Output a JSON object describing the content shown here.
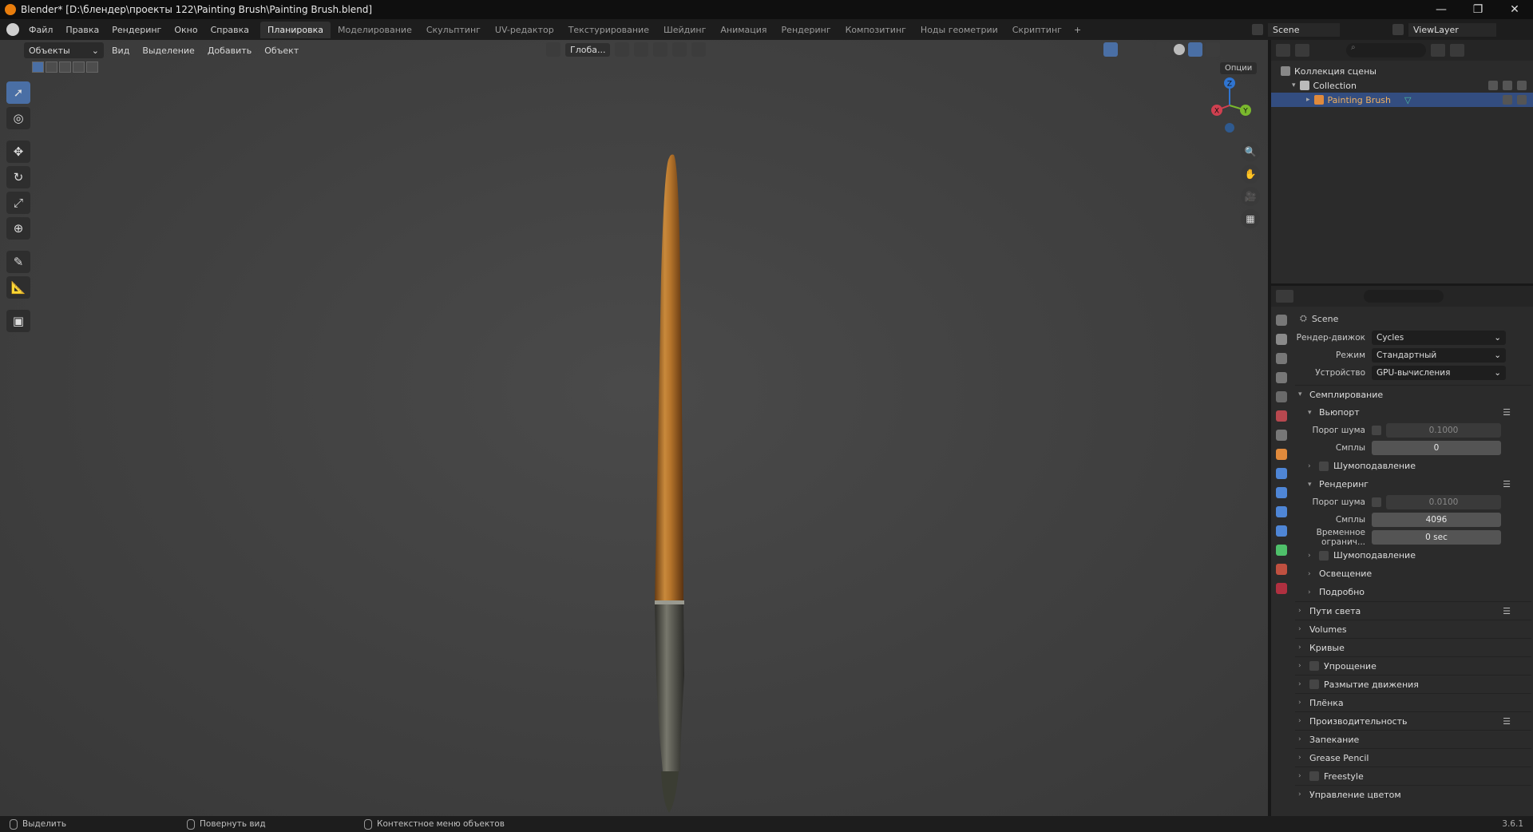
{
  "window": {
    "title": "Blender* [D:\\блендер\\проекты 122\\Painting Brush\\Painting Brush.blend]",
    "controls": [
      "—",
      "❐",
      "✕"
    ]
  },
  "menu": [
    "Файл",
    "Правка",
    "Рендеринг",
    "Окно",
    "Справка"
  ],
  "workspaces": {
    "tabs": [
      "Планировка",
      "Моделирование",
      "Скульптинг",
      "UV-редактор",
      "Текстурирование",
      "Шейдинг",
      "Анимация",
      "Рендеринг",
      "Композитинг",
      "Ноды геометрии",
      "Скриптинг"
    ],
    "active_index": 0,
    "add": "+"
  },
  "scene_selector": "Scene",
  "viewlayer_selector": "ViewLayer",
  "viewport": {
    "mode": "Объекты",
    "menus": [
      "Вид",
      "Выделение",
      "Добавить",
      "Объект"
    ],
    "orientation": "Глоба...",
    "options": "Опции"
  },
  "gizmo": {
    "z": "Z",
    "y": "Y",
    "x": "X"
  },
  "outliner": {
    "root": "Коллекция сцены",
    "collection": "Collection",
    "object": "Painting Brush"
  },
  "properties": {
    "context": "Scene",
    "render_engine": {
      "label": "Рендер-движок",
      "value": "Cycles"
    },
    "mode": {
      "label": "Режим",
      "value": "Стандартный"
    },
    "device": {
      "label": "Устройство",
      "value": "GPU-вычисления"
    },
    "sampling": "Семплирование",
    "viewport_sec": "Вьюпорт",
    "vp_noise": {
      "label": "Порог шума",
      "value": "0.1000"
    },
    "vp_samples": {
      "label": "Смплы",
      "value": "0"
    },
    "vp_denoise": "Шумоподавление",
    "render_sec": "Рендеринг",
    "r_noise": {
      "label": "Порог шума",
      "value": "0.0100"
    },
    "r_samples": {
      "label": "Смплы",
      "value": "4096"
    },
    "r_time": {
      "label": "Временное огранич...",
      "value": "0 sec"
    },
    "r_denoise": "Шумоподавление",
    "lights": "Освещение",
    "detail": "Подробно",
    "sections": [
      "Пути света",
      "Volumes",
      "Кривые",
      "Упрощение",
      "Размытие движения",
      "Плёнка",
      "Производительность",
      "Запекание",
      "Grease Pencil",
      "Freestyle",
      "Управление цветом"
    ]
  },
  "status": {
    "select": "Выделить",
    "rotate": "Повернуть вид",
    "context_menu": "Контекстное меню объектов",
    "version": "3.6.1"
  }
}
